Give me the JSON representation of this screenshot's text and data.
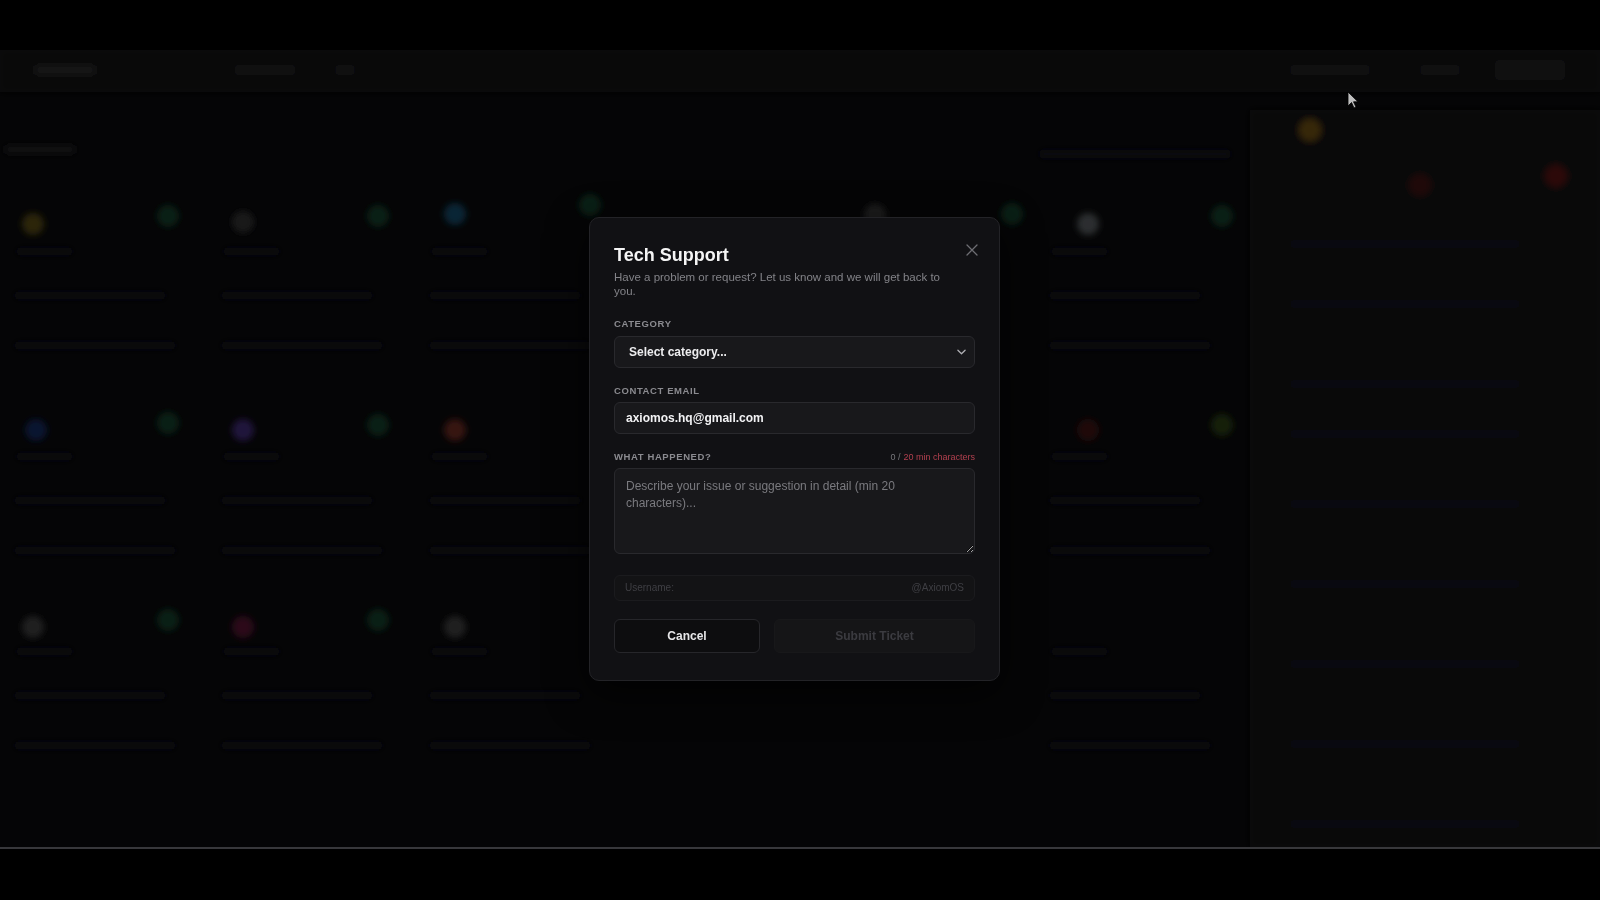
{
  "dialog": {
    "title": "Tech Support",
    "subtitle": "Have a problem or request? Let us know and we will get back to you.",
    "fields": [
      {
        "kind": "select",
        "label": "CATEGORY",
        "value": "Select category..."
      },
      {
        "kind": "input",
        "label": "CONTACT EMAIL",
        "value": "axiomos.hq@gmail.com"
      },
      {
        "kind": "textarea",
        "label": "WHAT HAPPENED?",
        "placeholder": "Describe your issue or suggestion in detail (min 20 characters)...",
        "counter": {
          "current": "0 /",
          "requirement": "20 min characters",
          "met": false
        }
      }
    ],
    "username": {
      "label": "Username:",
      "value": "@AxiomOS",
      "disabled": true
    },
    "buttons": [
      {
        "kind": "secondary",
        "label": "Cancel",
        "disabled": false
      },
      {
        "kind": "primary",
        "label": "Submit Ticket",
        "disabled": true
      }
    ]
  }
}
